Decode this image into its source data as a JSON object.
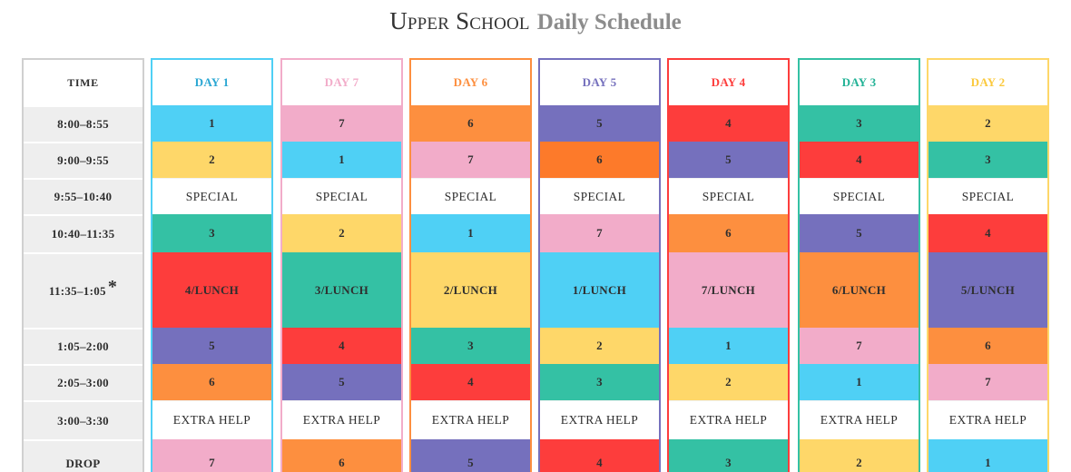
{
  "header": {
    "title_main": "Upper School",
    "title_sub": "Daily Schedule"
  },
  "colors": {
    "cyan": "#4fd0f5",
    "pink": "#f2acc9",
    "orange": "#fd8f3f",
    "purple": "#7570bd",
    "red": "#fd3d3c",
    "teal": "#34c1a4",
    "yellow": "#fed769",
    "time_bg": "#eeeeee"
  },
  "time_column": {
    "header": "TIME",
    "times": [
      "8:00–8:55",
      "9:00–9:55",
      "9:55–10:40",
      "10:40–11:35",
      "11:35–1:05",
      "1:05–2:00",
      "2:05–3:00",
      "3:00–3:30",
      "DROP"
    ],
    "lunch_marker": "*"
  },
  "days": [
    {
      "label": "DAY 1",
      "color": "#2aa7d3",
      "border": "#4fd0f5",
      "cells": [
        {
          "text": "1",
          "color": "#4fd0f5"
        },
        {
          "text": "2",
          "color": "#fed769"
        },
        {
          "text": "SPECIAL",
          "color": "#ffffff"
        },
        {
          "text": "3",
          "color": "#34c1a4"
        },
        {
          "text": "4/LUNCH",
          "color": "#fd3d3c"
        },
        {
          "text": "5",
          "color": "#7570bd"
        },
        {
          "text": "6",
          "color": "#fd8f3f"
        },
        {
          "text": "EXTRA HELP",
          "color": "#ffffff"
        },
        {
          "text": "7",
          "color": "#f2acc9"
        }
      ]
    },
    {
      "label": "DAY 7",
      "color": "#f2acc9",
      "border": "#f2acc9",
      "cells": [
        {
          "text": "7",
          "color": "#f2acc9"
        },
        {
          "text": "1",
          "color": "#4fd0f5"
        },
        {
          "text": "SPECIAL",
          "color": "#ffffff"
        },
        {
          "text": "2",
          "color": "#fed769"
        },
        {
          "text": "3/LUNCH",
          "color": "#34c1a4"
        },
        {
          "text": "4",
          "color": "#fd3d3c"
        },
        {
          "text": "5",
          "color": "#7570bd"
        },
        {
          "text": "EXTRA HELP",
          "color": "#ffffff"
        },
        {
          "text": "6",
          "color": "#fd8f3f"
        }
      ]
    },
    {
      "label": "DAY 6",
      "color": "#fd8f3f",
      "border": "#fd8f3f",
      "cells": [
        {
          "text": "6",
          "color": "#fd8f3f"
        },
        {
          "text": "7",
          "color": "#f2acc9"
        },
        {
          "text": "SPECIAL",
          "color": "#ffffff"
        },
        {
          "text": "1",
          "color": "#4fd0f5"
        },
        {
          "text": "2/LUNCH",
          "color": "#fed769"
        },
        {
          "text": "3",
          "color": "#34c1a4"
        },
        {
          "text": "4",
          "color": "#fd3d3c"
        },
        {
          "text": "EXTRA HELP",
          "color": "#ffffff"
        },
        {
          "text": "5",
          "color": "#7570bd"
        }
      ]
    },
    {
      "label": "DAY 5",
      "color": "#7570bd",
      "border": "#7570bd",
      "cells": [
        {
          "text": "5",
          "color": "#7570bd"
        },
        {
          "text": "6",
          "color": "#fd7a2a"
        },
        {
          "text": "SPECIAL",
          "color": "#ffffff"
        },
        {
          "text": "7",
          "color": "#f2acc9"
        },
        {
          "text": "1/LUNCH",
          "color": "#4fd0f5"
        },
        {
          "text": "2",
          "color": "#fed769"
        },
        {
          "text": "3",
          "color": "#34c1a4"
        },
        {
          "text": "EXTRA HELP",
          "color": "#ffffff"
        },
        {
          "text": "4",
          "color": "#fd3d3c"
        }
      ]
    },
    {
      "label": "DAY 4",
      "color": "#fd3d3c",
      "border": "#fd3d3c",
      "cells": [
        {
          "text": "4",
          "color": "#fd3d3c"
        },
        {
          "text": "5",
          "color": "#7570bd"
        },
        {
          "text": "SPECIAL",
          "color": "#ffffff"
        },
        {
          "text": "6",
          "color": "#fd8f3f"
        },
        {
          "text": "7/LUNCH",
          "color": "#f2acc9"
        },
        {
          "text": "1",
          "color": "#4fd0f5"
        },
        {
          "text": "2",
          "color": "#fed769"
        },
        {
          "text": "EXTRA HELP",
          "color": "#ffffff"
        },
        {
          "text": "3",
          "color": "#34c1a4"
        }
      ]
    },
    {
      "label": "DAY 3",
      "color": "#22b296",
      "border": "#34c1a4",
      "cells": [
        {
          "text": "3",
          "color": "#34c1a4"
        },
        {
          "text": "4",
          "color": "#fd3d3c"
        },
        {
          "text": "SPECIAL",
          "color": "#ffffff"
        },
        {
          "text": "5",
          "color": "#7570bd"
        },
        {
          "text": "6/LUNCH",
          "color": "#fd8f3f"
        },
        {
          "text": "7",
          "color": "#f2acc9"
        },
        {
          "text": "1",
          "color": "#4fd0f5"
        },
        {
          "text": "EXTRA HELP",
          "color": "#ffffff"
        },
        {
          "text": "2",
          "color": "#fed769"
        }
      ]
    },
    {
      "label": "DAY 2",
      "color": "#fbc93d",
      "border": "#fed769",
      "cells": [
        {
          "text": "2",
          "color": "#fed769"
        },
        {
          "text": "3",
          "color": "#34c1a4"
        },
        {
          "text": "SPECIAL",
          "color": "#ffffff"
        },
        {
          "text": "4",
          "color": "#fd3d3c"
        },
        {
          "text": "5/LUNCH",
          "color": "#7570bd"
        },
        {
          "text": "6",
          "color": "#fd8f3f"
        },
        {
          "text": "7",
          "color": "#f2acc9"
        },
        {
          "text": "EXTRA HELP",
          "color": "#ffffff"
        },
        {
          "text": "1",
          "color": "#4fd0f5"
        }
      ]
    }
  ]
}
